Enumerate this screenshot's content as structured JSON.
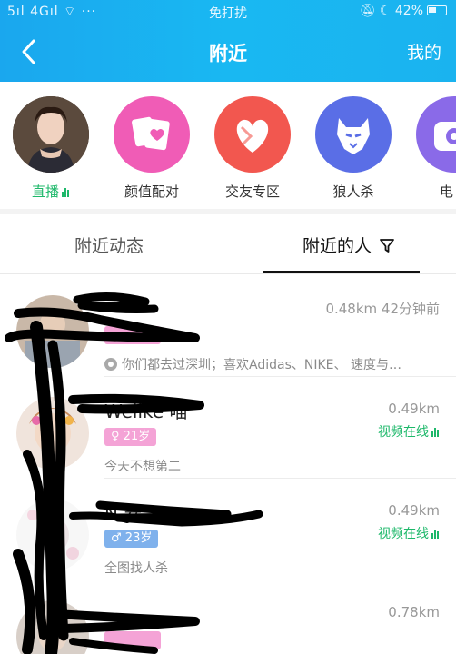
{
  "status_bar": {
    "signal": "5ıl 4Gıl",
    "dots": "···",
    "center": "免打扰",
    "battery": "42%"
  },
  "navbar": {
    "title": "附近",
    "right_label": "我的"
  },
  "shortcuts": [
    {
      "label": "直播",
      "icon": "live-avatar"
    },
    {
      "label": "颜值配对",
      "icon": "cards-heart-icon",
      "color": "#f05cb6"
    },
    {
      "label": "交友专区",
      "icon": "heart-icon",
      "color": "#f2574f"
    },
    {
      "label": "狼人杀",
      "icon": "wolf-icon",
      "color": "#5a6ee6"
    },
    {
      "label": "电",
      "icon": "camera-icon",
      "color": "#8a6ae8"
    }
  ],
  "tabs": [
    {
      "label": "附近动态",
      "active": false
    },
    {
      "label": "附近的人",
      "active": true,
      "icon": "filter-icon"
    }
  ],
  "people": [
    {
      "name": "",
      "badge": "",
      "gender": "female",
      "meta": "0.48km 42分钟前",
      "online": "",
      "signature": "你们都去过深圳；喜欢Adidas、NIKE、 速度与…"
    },
    {
      "name": "Welike 喵",
      "badge": "21岁",
      "gender": "female",
      "meta": "0.49km",
      "online": "视频在线",
      "signature": "今天不想第二"
    },
    {
      "name": "N 安",
      "badge": "23岁",
      "gender": "male",
      "meta": "0.49km",
      "online": "视频在线",
      "signature": "全图找人杀"
    },
    {
      "name": "",
      "badge": "",
      "gender": "female",
      "meta": "0.78km",
      "online": "",
      "signature": ""
    }
  ],
  "colors": {
    "header": "#1aa7ee",
    "online_green": "#1db86a",
    "female_badge": "#f4a3d6",
    "male_badge": "#7fb1ec"
  }
}
